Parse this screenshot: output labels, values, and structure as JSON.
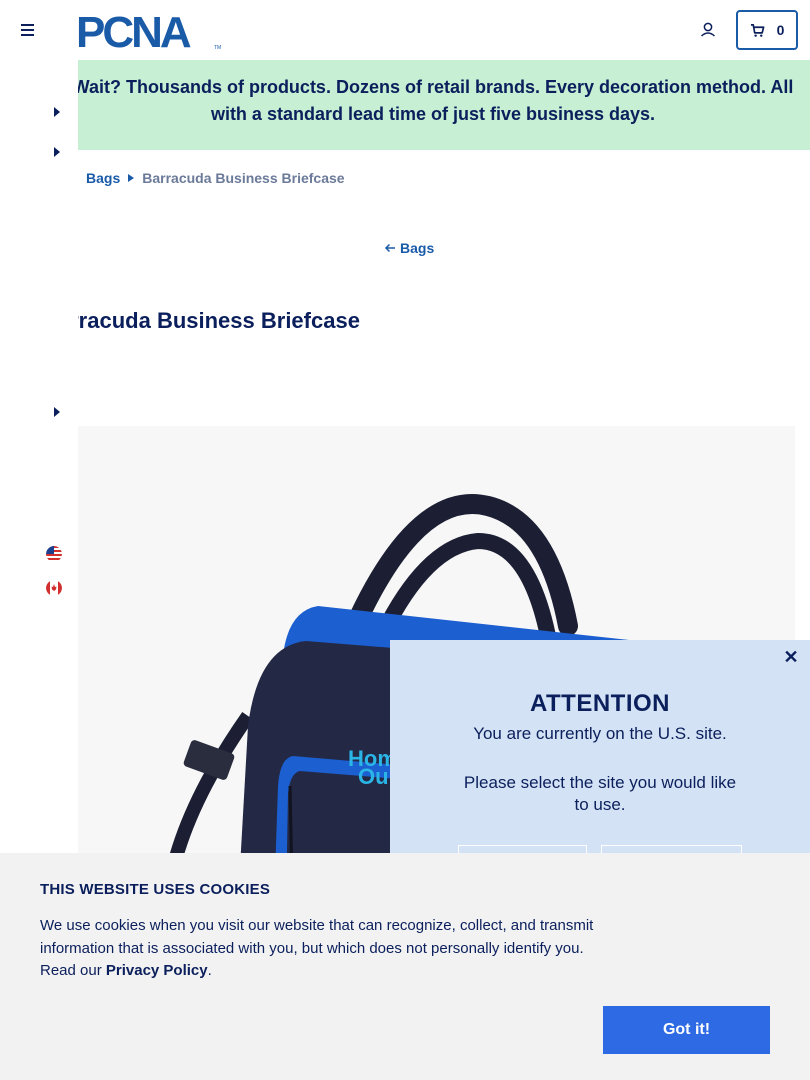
{
  "header": {
    "logo_text": "PCNA",
    "logo_tm": "TM",
    "cart_count": "0",
    "colors": {
      "brand": "#1a5ba8",
      "navy": "#0b1f5c"
    }
  },
  "promo": {
    "text": "Wait? Thousands of products. Dozens of retail brands. Every decoration method. All with a standard lead time of just five business days.",
    "background": "#c6efd3"
  },
  "breadcrumb": {
    "items": [
      {
        "label": "Bags"
      },
      {
        "label": "Barracuda Business Briefcase"
      }
    ]
  },
  "back_link": {
    "label": "Bags"
  },
  "product": {
    "title": "Barracuda Business Briefcase",
    "imprint_text": "Home Outf"
  },
  "modal": {
    "title": "ATTENTION",
    "message": "You are currently on the U.S. site.",
    "prompt": "Please select the site you would like to use.",
    "close_glyph": "✕"
  },
  "cookie": {
    "title": "THIS WEBSITE USES COOKIES",
    "body": "We use cookies when you visit our website that can recognize, collect, and transmit information that is associated with you, but which does not personally identify you. Read our ",
    "privacy_link": "Privacy Policy",
    "body_end": ".",
    "accept_label": "Got it!",
    "accent": "#2d6ae3"
  }
}
